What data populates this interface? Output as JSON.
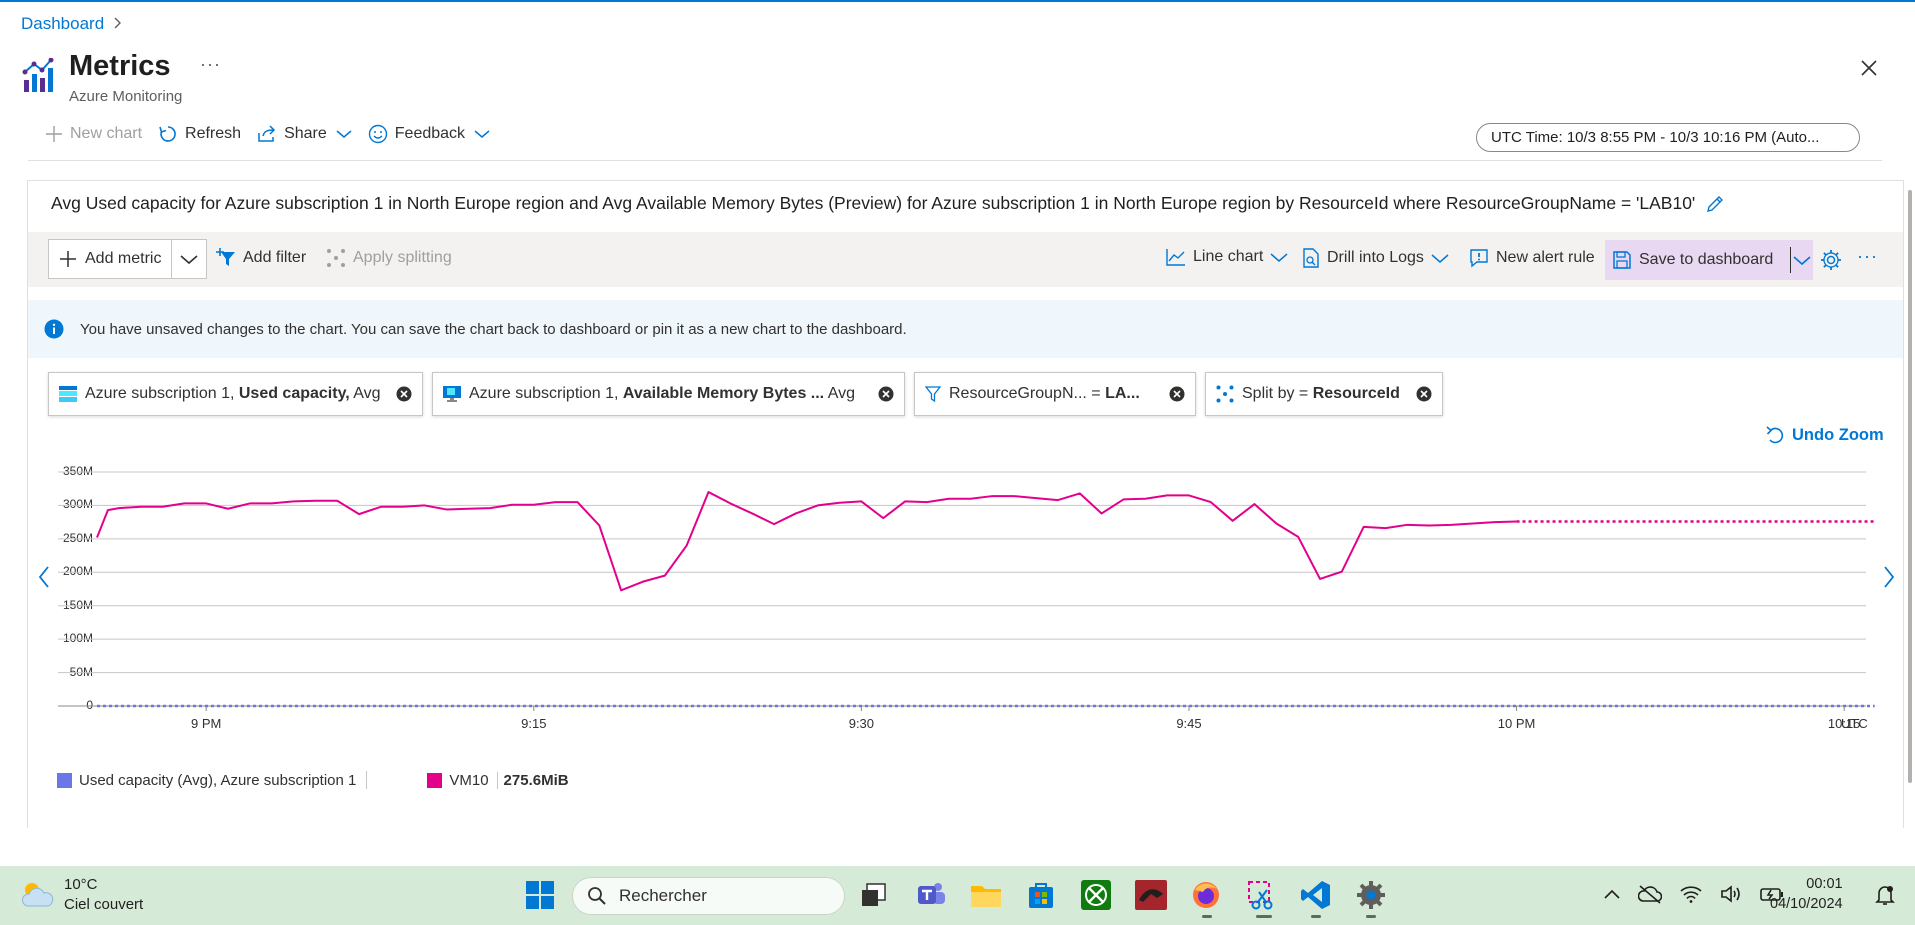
{
  "breadcrumb": {
    "root": "Dashboard",
    "sep": ">"
  },
  "header": {
    "title": "Metrics",
    "subtitle": "Azure Monitoring",
    "more": "···"
  },
  "commands": {
    "new_chart": "New chart",
    "refresh": "Refresh",
    "share": "Share",
    "feedback": "Feedback",
    "time_range": "UTC Time: 10/3 8:55 PM - 10/3 10:16 PM (Auto..."
  },
  "chart_panel": {
    "title": "Avg Used capacity for Azure subscription 1 in North Europe region and Avg Available Memory Bytes (Preview) for Azure subscription 1 in North Europe region by ResourceId where ResourceGroupName = 'LAB10'",
    "toolbar": {
      "add_metric": "Add metric",
      "add_filter": "Add filter",
      "apply_splitting": "Apply splitting",
      "line_chart": "Line chart",
      "drill_logs": "Drill into Logs",
      "new_alert": "New alert rule",
      "save_dashboard": "Save to dashboard",
      "more": "···"
    },
    "info": "You have unsaved changes to the chart. You can save the chart back to dashboard or pin it as a new chart to the dashboard.",
    "pills": [
      {
        "prefix": "Azure subscription 1,",
        "bold": "Used capacity,",
        "suffix": "Avg"
      },
      {
        "prefix": "Azure subscription 1,",
        "bold": "Available Memory Bytes ...",
        "suffix": "Avg"
      },
      {
        "prefix": "ResourceGroupN...",
        "op": "=",
        "bold": "LA..."
      },
      {
        "prefix": "Split by =",
        "bold": "ResourceId"
      }
    ],
    "undo_zoom": "Undo Zoom",
    "legend": [
      {
        "label": "Used capacity (Avg), Azure subscription 1",
        "color": "#6b76e8"
      },
      {
        "label": "VM10",
        "value": "275.6MiB",
        "color": "#e3008c"
      }
    ]
  },
  "chart_data": {
    "type": "line",
    "y_ticks": [
      "350M",
      "300M",
      "250M",
      "200M",
      "150M",
      "100M",
      "50M",
      "0"
    ],
    "ylim": [
      0,
      350
    ],
    "x_ticks": [
      {
        "label": "9 PM",
        "minute": 5
      },
      {
        "label": "9:15",
        "minute": 20
      },
      {
        "label": "9:30",
        "minute": 35
      },
      {
        "label": "9:45",
        "minute": 50
      },
      {
        "label": "10 PM",
        "minute": 65
      },
      {
        "label": "10:15",
        "minute": 80
      }
    ],
    "x_unit": "UTC",
    "xlim": [
      0,
      81
    ],
    "grid": true,
    "series": [
      {
        "name": "VM10",
        "color": "#e3008c",
        "x": [
          0,
          0.5,
          1,
          2,
          3,
          4,
          5,
          6,
          7,
          8,
          9,
          10,
          11,
          12,
          13,
          14,
          15,
          16,
          17,
          18,
          19,
          20,
          21,
          22,
          23,
          24,
          25,
          26,
          27,
          28,
          29,
          30,
          31,
          32,
          33,
          34,
          35,
          36,
          37,
          38,
          39,
          40,
          41,
          42,
          43,
          44,
          45,
          46,
          47,
          48,
          49,
          50,
          51,
          52,
          53,
          54,
          55,
          56,
          57,
          58,
          59,
          60,
          61,
          62,
          63,
          64,
          65
        ],
        "values": [
          252,
          293,
          296,
          298,
          298,
          303,
          303,
          295,
          303,
          303,
          306,
          307,
          307,
          287,
          298,
          298,
          300,
          294,
          295,
          296,
          301,
          301,
          305,
          305,
          270,
          173,
          186,
          195,
          240,
          320,
          303,
          288,
          272,
          288,
          300,
          304,
          306,
          281,
          306,
          305,
          310,
          310,
          314,
          314,
          311,
          308,
          318,
          288,
          309,
          310,
          315,
          315,
          305,
          277,
          302,
          273,
          253,
          190,
          201,
          268,
          266,
          271,
          270,
          271,
          273,
          275,
          276
        ]
      },
      {
        "name": "VM10 (projection)",
        "color": "#e3008c",
        "dashed": true,
        "x": [
          65,
          82
        ],
        "values": [
          276,
          276
        ]
      },
      {
        "name": "Used capacity (Avg), Azure subscription 1",
        "color": "#6b76e8",
        "dashed": true,
        "x": [
          0,
          82
        ],
        "values": [
          0,
          0
        ]
      }
    ]
  },
  "taskbar": {
    "weather_temp": "10°C",
    "weather_desc": "Ciel couvert",
    "search": "Rechercher",
    "time": "00:01",
    "date": "04/10/2024"
  }
}
